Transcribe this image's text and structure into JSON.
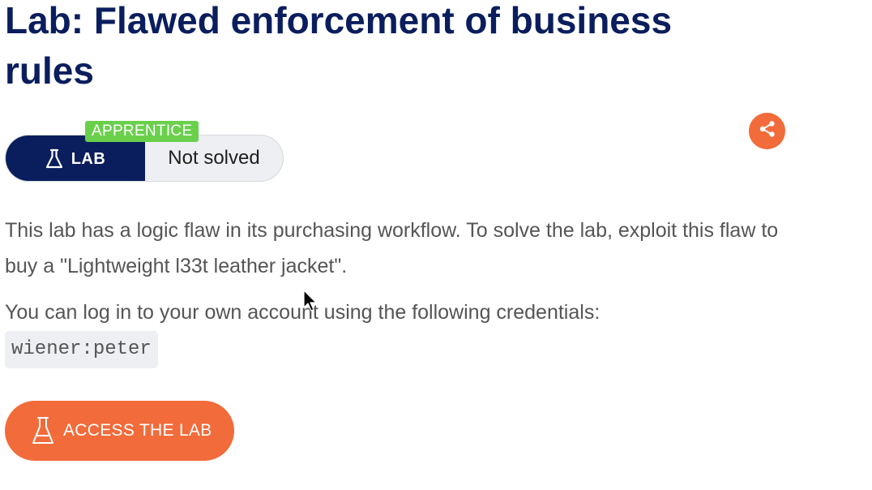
{
  "lab": {
    "title": "Lab: Flawed enforcement of business rules",
    "level_badge": "APPRENTICE",
    "type_label": "LAB",
    "status": "Not solved",
    "share_icon": "share-icon",
    "lab_icon": "flask-icon"
  },
  "description": {
    "paragraph": "This lab has a logic flaw in its purchasing workflow. To solve the lab, exploit this flaw to buy a \"Lightweight l33t leather jacket\".",
    "credentials_intro": "You can log in to your own account using the following credentials:",
    "credentials": "wiener:peter"
  },
  "cta": {
    "label": "ACCESS THE LAB",
    "icon": "flask-icon"
  },
  "colors": {
    "title": "#0a1e5e",
    "accent": "#f26b3a",
    "badge": "#6ad04c",
    "lab_segment": "#0a1e5e",
    "text": "#555555"
  }
}
